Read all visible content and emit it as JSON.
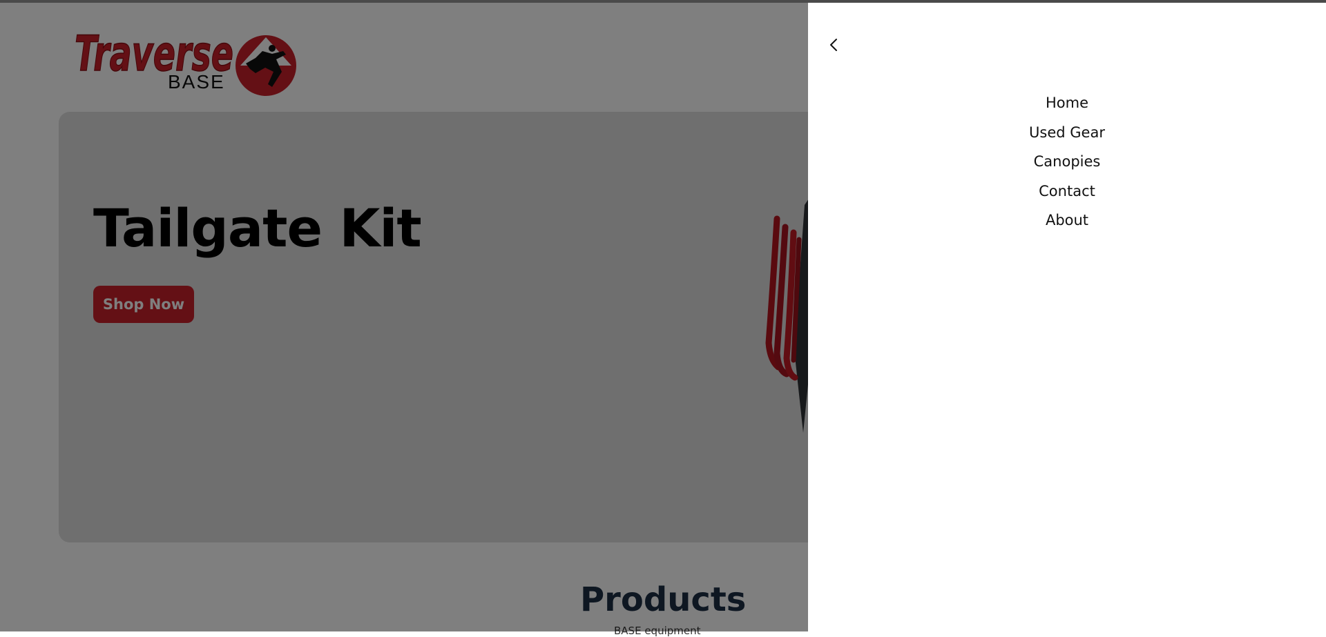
{
  "logo": {
    "wordmark": "Traverse",
    "subtext": "BASE",
    "icon": "base-jumper-logo-icon"
  },
  "hero": {
    "title": "Tailgate Kit",
    "cta_label": "Shop Now",
    "product_image": "tailgate-kit-product-image"
  },
  "products": {
    "heading": "Products",
    "subheading": "BASE equipment"
  },
  "drawer": {
    "back_icon": "chevron-left-icon",
    "nav_items": [
      {
        "label": "Home"
      },
      {
        "label": "Used Gear"
      },
      {
        "label": "Canopies"
      },
      {
        "label": "Contact"
      },
      {
        "label": "About"
      }
    ]
  },
  "colors": {
    "brand_red": "#c8202a",
    "heading_navy": "#1c2e45",
    "hero_bg": "#dedede",
    "overlay": "rgba(0,0,0,0.5)"
  }
}
